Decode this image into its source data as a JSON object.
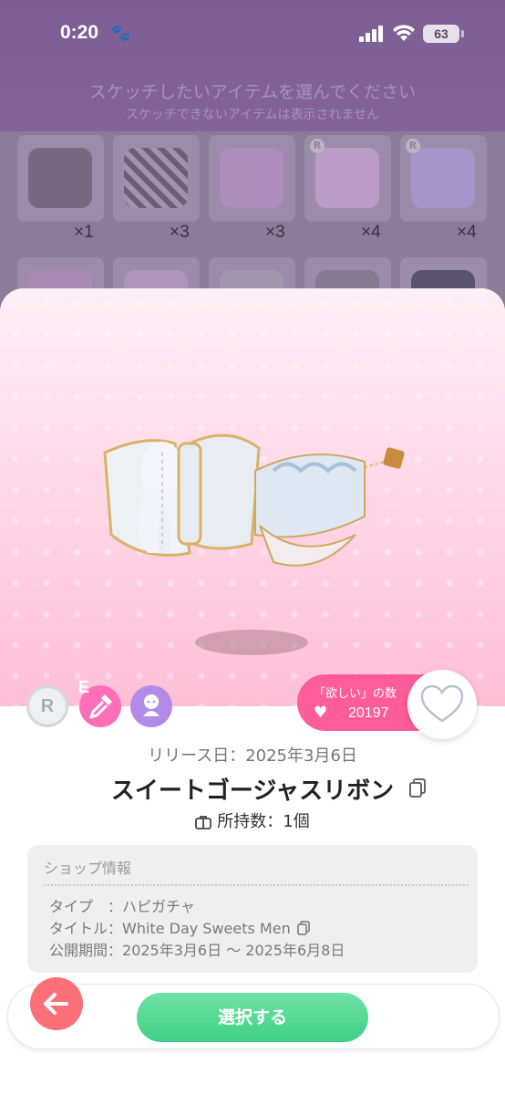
{
  "status_bar": {
    "time": "0:20",
    "battery": "63"
  },
  "header": {
    "title": "スケッチしたいアイテムを選んでください",
    "subtitle": "スケッチできないアイテムは表示されません"
  },
  "grid": {
    "counts": [
      "×1",
      "×3",
      "×3",
      "×4",
      "×4"
    ]
  },
  "badges": {
    "rarity": "R",
    "edit": "E"
  },
  "wishlist": {
    "label": "「欲しい」の数",
    "count": "20197"
  },
  "item": {
    "release": "リリース日：2025年3月6日",
    "name": "スイートゴージャスリボン",
    "owned": "所持数：1個"
  },
  "shop": {
    "heading": "ショップ情報",
    "type_label": "タイプ",
    "type_sep": "　：",
    "type_value": "ハピガチャ",
    "title_label": "タイトル：",
    "title_value": "White Day Sweets Men",
    "period_label": "公開期間：",
    "period_value": "2025年3月6日 ～ 2025年6月8日"
  },
  "actions": {
    "select": "選択する"
  },
  "icons": [
    "paw-icon",
    "signal-icon",
    "wifi-icon",
    "battery-icon",
    "copy-icon",
    "bag-icon",
    "heart-icon",
    "arrow-left-icon",
    "eyedropper-icon",
    "doll-icon"
  ],
  "colors": {
    "pink": "#ff5c9a",
    "green": "#3fcf86",
    "back": "#ff6f78"
  }
}
